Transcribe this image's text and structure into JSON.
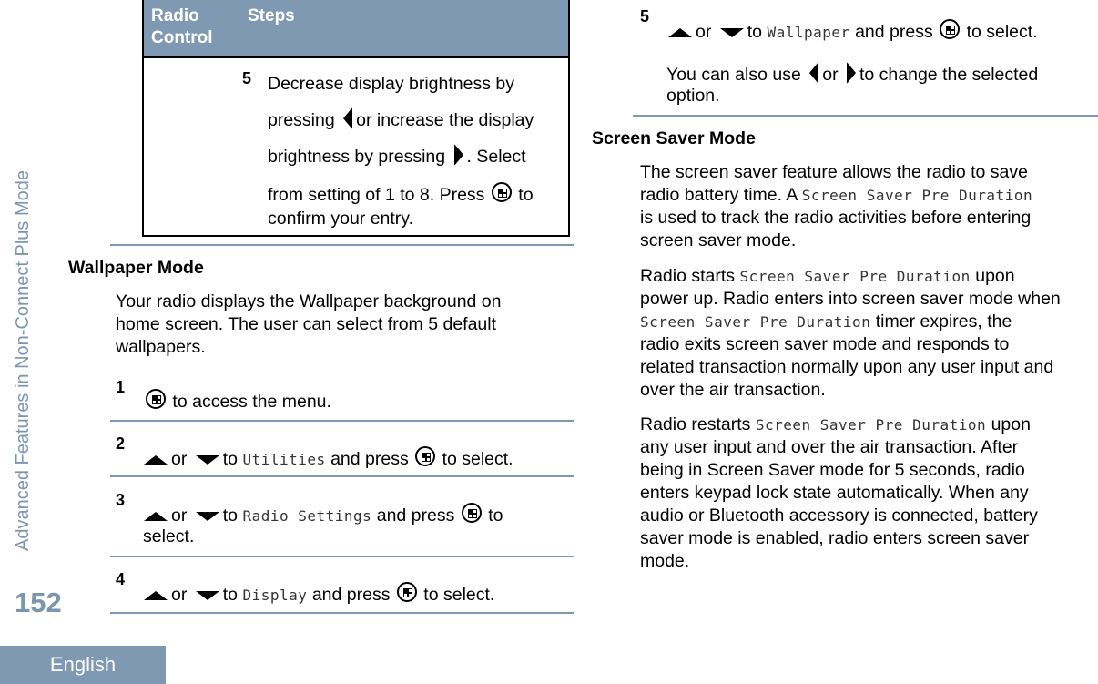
{
  "sidebar": {
    "chapter_title": "Advanced Features in Non-Connect Plus Mode",
    "page_number": "152",
    "language_tab": "English"
  },
  "table": {
    "headers": {
      "col1": "Radio Control",
      "col1_line1": "Radio",
      "col1_line2": "Control",
      "col2": "Steps"
    },
    "row": {
      "step_number": "5",
      "line1": "Decrease display brightness by",
      "line2_a": "pressing",
      "line2_b": "or increase the display",
      "line3_a": "brightness by pressing",
      "line3_b": ". Select",
      "line4_a": "from setting of 1 to 8. Press",
      "line4_b": "to",
      "line5": "confirm your entry."
    }
  },
  "wallpaper": {
    "heading": "Wallpaper Mode",
    "intro": "Your radio displays the Wallpaper background on home screen. The user can select from 5 default wallpapers.",
    "intro_lines": [
      "Your radio displays the Wallpaper background on",
      "home screen. The user can select from 5 default",
      "wallpapers."
    ],
    "steps": [
      {
        "num": "1",
        "text": "to access the menu."
      },
      {
        "num": "2",
        "or": "or",
        "to": "to",
        "menu_item": "Utilities",
        "tail": "and press",
        "end": "to select."
      },
      {
        "num": "3",
        "or": "or",
        "to": "to",
        "menu_item": "Radio Settings",
        "tail": "and press",
        "end": "to",
        "end2": "select."
      },
      {
        "num": "4",
        "or": "or",
        "to": "to",
        "menu_item": "Display",
        "tail": "and press",
        "end": "to select."
      },
      {
        "num": "5",
        "or": "or",
        "to": "to",
        "menu_item": "Wallpaper",
        "tail": "and press",
        "end": "to select.",
        "note_a": "You can also use",
        "note_or": "or",
        "note_b": "to change the selected",
        "note_c": "option."
      }
    ]
  },
  "screen_saver": {
    "heading": "Screen Saver Mode",
    "term": "Screen Saver Pre Duration",
    "p1": {
      "l1": "The screen saver feature allows the radio to save",
      "l2a": "radio battery time. A",
      "l3": "is used to track the radio activities before entering",
      "l4": "screen saver mode."
    },
    "p2": {
      "l1a": "Radio starts",
      "l1b": "upon",
      "l2": "power up. Radio enters into screen saver mode when",
      "l3b": "timer expires, the",
      "l4": "radio exits screen saver mode and responds to",
      "l5": "related transaction normally upon any user input and",
      "l6": "over the air transaction."
    },
    "p3": {
      "l1a": "Radio restarts",
      "l1b": "upon",
      "l2": "any user input and over the air transaction. After",
      "l3": "being in Screen Saver mode for 5 seconds, radio",
      "l4": "enters keypad lock state automatically. When any",
      "l5": "audio or Bluetooth accessory is connected, battery",
      "l6": "saver mode is enabled, radio enters screen saver",
      "l7": "mode."
    }
  }
}
